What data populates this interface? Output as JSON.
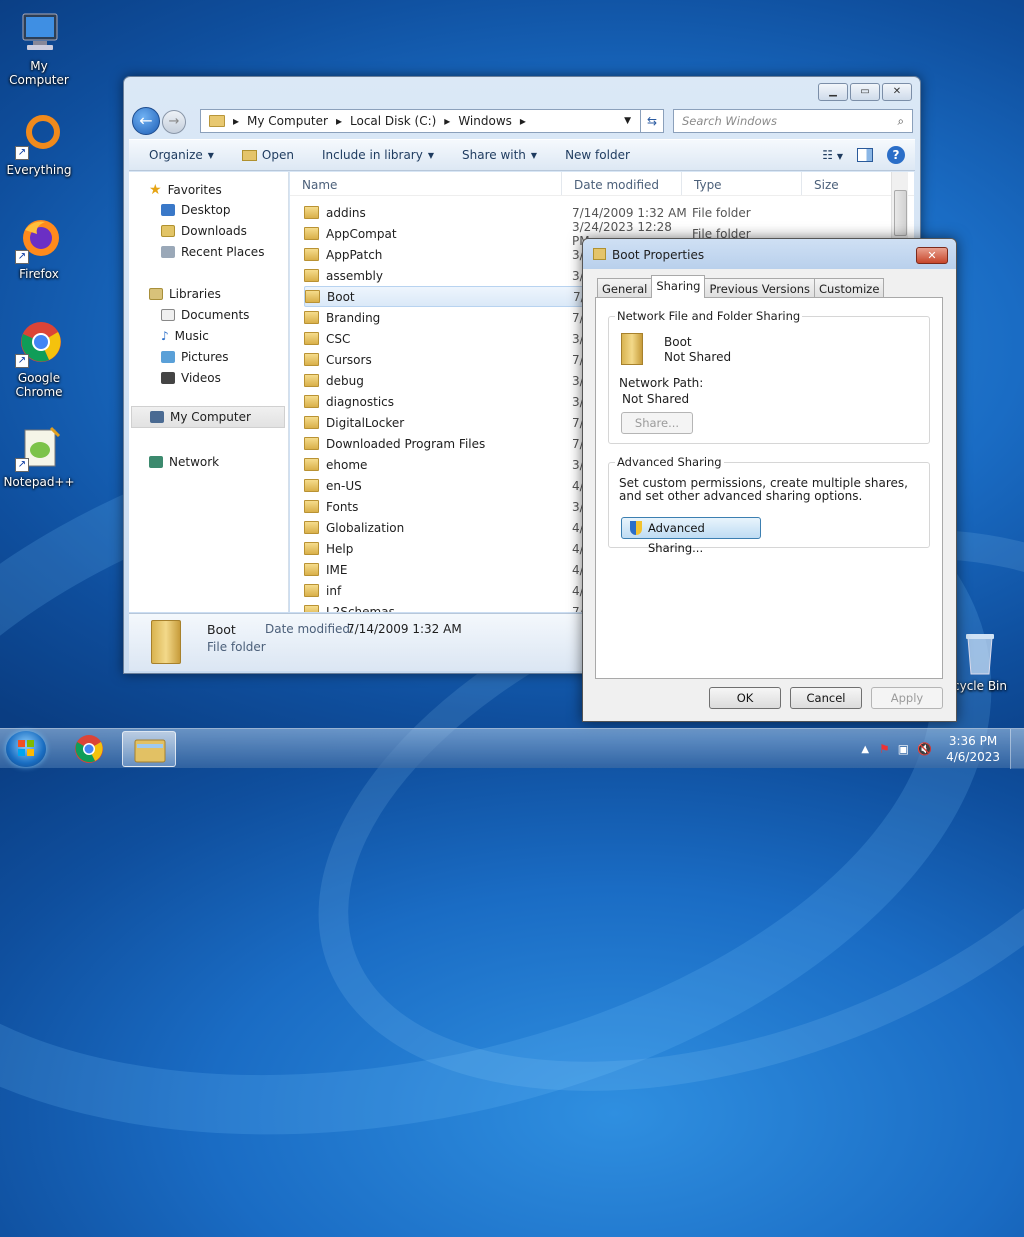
{
  "desktop": {
    "icons": [
      {
        "label": "My Computer"
      },
      {
        "label": "Everything"
      },
      {
        "label": "Firefox"
      },
      {
        "label": "Google Chrome"
      },
      {
        "label": "Notepad++"
      },
      {
        "label": "cycle Bin"
      }
    ]
  },
  "explorer": {
    "breadcrumb": [
      "My Computer",
      "Local Disk (C:)",
      "Windows"
    ],
    "search_placeholder": "Search Windows",
    "toolbar": {
      "organize": "Organize",
      "open": "Open",
      "include": "Include in library",
      "share": "Share with",
      "newfolder": "New folder"
    },
    "nav": {
      "favorites": "Favorites",
      "desktop": "Desktop",
      "downloads": "Downloads",
      "recent": "Recent Places",
      "libraries": "Libraries",
      "documents": "Documents",
      "music": "Music",
      "pictures": "Pictures",
      "videos": "Videos",
      "mycomputer": "My Computer",
      "network": "Network"
    },
    "columns": {
      "name": "Name",
      "date": "Date modified",
      "type": "Type",
      "size": "Size"
    },
    "files": [
      {
        "name": "addins",
        "date": "7/14/2009 1:32 AM",
        "type": "File folder"
      },
      {
        "name": "AppCompat",
        "date": "3/24/2023 12:28 PM",
        "type": "File folder"
      },
      {
        "name": "AppPatch",
        "date": "3/",
        "type": ""
      },
      {
        "name": "assembly",
        "date": "3/",
        "type": ""
      },
      {
        "name": "Boot",
        "date": "7/",
        "type": ""
      },
      {
        "name": "Branding",
        "date": "7/",
        "type": ""
      },
      {
        "name": "CSC",
        "date": "3/",
        "type": ""
      },
      {
        "name": "Cursors",
        "date": "7/",
        "type": ""
      },
      {
        "name": "debug",
        "date": "3/",
        "type": ""
      },
      {
        "name": "diagnostics",
        "date": "3/",
        "type": ""
      },
      {
        "name": "DigitalLocker",
        "date": "7/",
        "type": ""
      },
      {
        "name": "Downloaded Program Files",
        "date": "7/",
        "type": ""
      },
      {
        "name": "ehome",
        "date": "3/",
        "type": ""
      },
      {
        "name": "en-US",
        "date": "4/",
        "type": ""
      },
      {
        "name": "Fonts",
        "date": "3/",
        "type": ""
      },
      {
        "name": "Globalization",
        "date": "4/",
        "type": ""
      },
      {
        "name": "Help",
        "date": "4/",
        "type": ""
      },
      {
        "name": "IME",
        "date": "4/",
        "type": ""
      },
      {
        "name": "inf",
        "date": "4/",
        "type": ""
      },
      {
        "name": "L2Schemas",
        "date": "7/",
        "type": ""
      }
    ],
    "details": {
      "name": "Boot",
      "date_label": "Date modified:",
      "date": "7/14/2009 1:32 AM",
      "type": "File folder"
    }
  },
  "dialog": {
    "title": "Boot Properties",
    "tabs": [
      "General",
      "Sharing",
      "Previous Versions",
      "Customize"
    ],
    "network_sharing_label": "Network File and Folder Sharing",
    "folder_name": "Boot",
    "folder_status": "Not Shared",
    "network_path_label": "Network Path:",
    "network_path": "Not Shared",
    "share_button": "Share...",
    "advanced_label": "Advanced Sharing",
    "advanced_desc": "Set custom permissions, create multiple shares, and set other advanced sharing options.",
    "advanced_button": "Advanced Sharing...",
    "ok": "OK",
    "cancel": "Cancel",
    "apply": "Apply"
  },
  "taskbar": {
    "time": "3:36 PM",
    "date": "4/6/2023"
  }
}
